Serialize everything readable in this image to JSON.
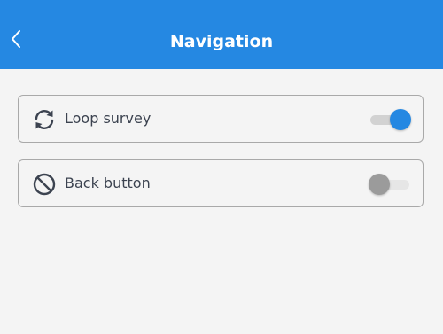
{
  "header": {
    "title": "Navigation",
    "back_icon": "chevron-left-icon"
  },
  "settings": [
    {
      "label": "Loop survey",
      "icon": "loop-icon",
      "enabled": true
    },
    {
      "label": "Back button",
      "icon": "prohibited-icon",
      "enabled": false
    }
  ],
  "colors": {
    "header_bg": "#2588e2",
    "toggle_on": "#2588e2",
    "toggle_off": "#9b9b9b",
    "background": "#f4f4f4"
  }
}
